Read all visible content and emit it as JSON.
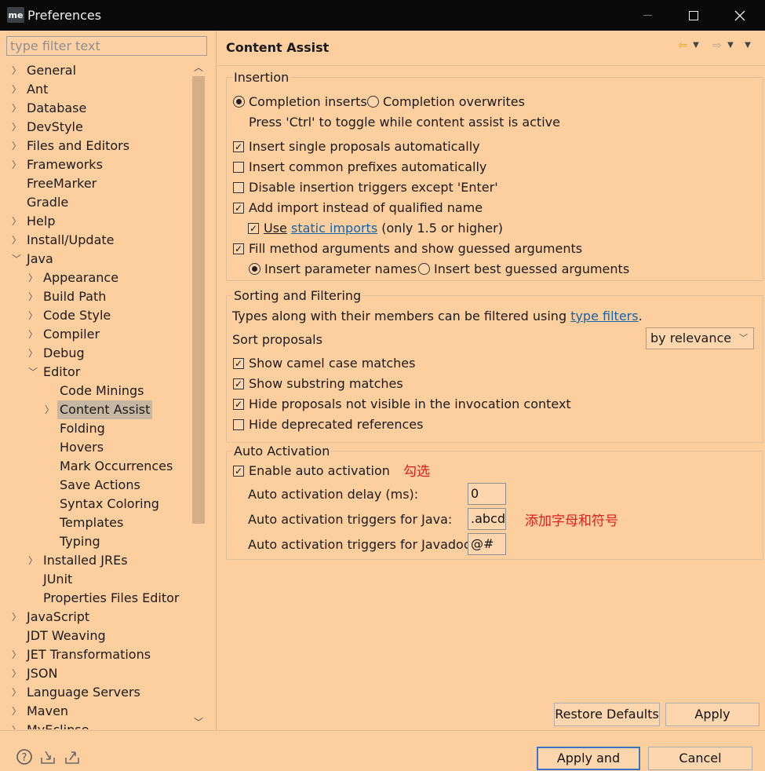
{
  "window": {
    "title": "Preferences",
    "app_icon_text": "me"
  },
  "filter": {
    "placeholder": "type filter text"
  },
  "tree": [
    {
      "label": "General",
      "indent": 0,
      "chevron": "right"
    },
    {
      "label": "Ant",
      "indent": 0,
      "chevron": "right"
    },
    {
      "label": "Database",
      "indent": 0,
      "chevron": "right"
    },
    {
      "label": "DevStyle",
      "indent": 0,
      "chevron": "right"
    },
    {
      "label": "Files and Editors",
      "indent": 0,
      "chevron": "right"
    },
    {
      "label": "Frameworks",
      "indent": 0,
      "chevron": "right"
    },
    {
      "label": "FreeMarker",
      "indent": 0,
      "chevron": "none"
    },
    {
      "label": "Gradle",
      "indent": 0,
      "chevron": "none"
    },
    {
      "label": "Help",
      "indent": 0,
      "chevron": "right"
    },
    {
      "label": "Install/Update",
      "indent": 0,
      "chevron": "right"
    },
    {
      "label": "Java",
      "indent": 0,
      "chevron": "down"
    },
    {
      "label": "Appearance",
      "indent": 1,
      "chevron": "right"
    },
    {
      "label": "Build Path",
      "indent": 1,
      "chevron": "right"
    },
    {
      "label": "Code Style",
      "indent": 1,
      "chevron": "right"
    },
    {
      "label": "Compiler",
      "indent": 1,
      "chevron": "right"
    },
    {
      "label": "Debug",
      "indent": 1,
      "chevron": "right"
    },
    {
      "label": "Editor",
      "indent": 1,
      "chevron": "down"
    },
    {
      "label": "Code Minings",
      "indent": 2,
      "chevron": "none"
    },
    {
      "label": "Content Assist",
      "indent": 2,
      "chevron": "right",
      "selected": true
    },
    {
      "label": "Folding",
      "indent": 2,
      "chevron": "none"
    },
    {
      "label": "Hovers",
      "indent": 2,
      "chevron": "none"
    },
    {
      "label": "Mark Occurrences",
      "indent": 2,
      "chevron": "none"
    },
    {
      "label": "Save Actions",
      "indent": 2,
      "chevron": "none"
    },
    {
      "label": "Syntax Coloring",
      "indent": 2,
      "chevron": "none"
    },
    {
      "label": "Templates",
      "indent": 2,
      "chevron": "none"
    },
    {
      "label": "Typing",
      "indent": 2,
      "chevron": "none"
    },
    {
      "label": "Installed JREs",
      "indent": 1,
      "chevron": "right"
    },
    {
      "label": "JUnit",
      "indent": 1,
      "chevron": "none"
    },
    {
      "label": "Properties Files Editor",
      "indent": 1,
      "chevron": "none"
    },
    {
      "label": "JavaScript",
      "indent": 0,
      "chevron": "right"
    },
    {
      "label": "JDT Weaving",
      "indent": 0,
      "chevron": "none"
    },
    {
      "label": "JET Transformations",
      "indent": 0,
      "chevron": "right"
    },
    {
      "label": "JSON",
      "indent": 0,
      "chevron": "right"
    },
    {
      "label": "Language Servers",
      "indent": 0,
      "chevron": "right"
    },
    {
      "label": "Maven",
      "indent": 0,
      "chevron": "right"
    },
    {
      "label": "MyEclipse",
      "indent": 0,
      "chevron": "right"
    }
  ],
  "page": {
    "title": "Content Assist"
  },
  "insertion": {
    "title": "Insertion",
    "completion_inserts": "Completion inserts",
    "completion_overwrites": "Completion overwrites",
    "toggle_hint": "Press 'Ctrl' to toggle while content assist is active",
    "insert_single": "Insert single proposals automatically",
    "insert_common": "Insert common prefixes automatically",
    "disable_triggers": "Disable insertion triggers except 'Enter'",
    "add_import": "Add import instead of qualified name",
    "use_prefix": "Use",
    "static_imports_link": "static imports",
    "use_suffix": "(only 1.5 or higher)",
    "fill_method_args": "Fill method arguments and show guessed arguments",
    "insert_param_names": "Insert parameter names",
    "insert_best_guessed": "Insert best guessed arguments"
  },
  "sorting": {
    "title": "Sorting and Filtering",
    "desc_prefix": "Types along with their members can be filtered using",
    "type_filters_link": "type filters",
    "desc_suffix": ".",
    "sort_label": "Sort proposals",
    "sort_value": "by relevance",
    "camel_case": "Show camel case matches",
    "substring": "Show substring matches",
    "hide_not_visible": "Hide proposals not visible in the invocation context",
    "hide_deprecated": "Hide deprecated references"
  },
  "auto": {
    "title": "Auto Activation",
    "enable": "Enable auto activation",
    "annotation_check": "勾选",
    "delay_label": "Auto activation delay (ms):",
    "delay_value": "0",
    "java_label": "Auto activation triggers for Java:",
    "java_value": ".abcd",
    "annotation_add": "添加字母和符号",
    "javadoc_label": "Auto activation triggers for Javadoc:",
    "javadoc_value": "@#"
  },
  "buttons": {
    "restore_defaults": "Restore Defaults",
    "apply": "Apply",
    "apply_and_close": "Apply and Close",
    "cancel": "Cancel"
  }
}
